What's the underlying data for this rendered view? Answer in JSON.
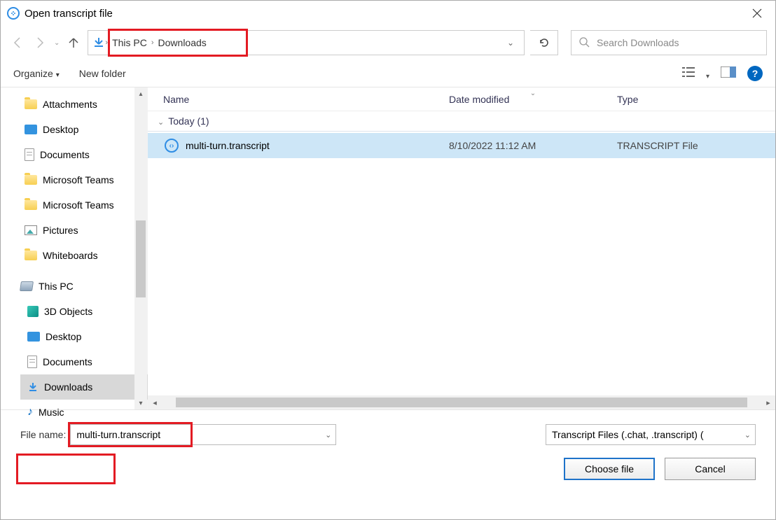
{
  "title": "Open transcript file",
  "path": {
    "seg1": "This PC",
    "seg2": "Downloads"
  },
  "search": {
    "placeholder": "Search Downloads"
  },
  "toolbar": {
    "organize": "Organize",
    "newfolder": "New folder"
  },
  "tree": {
    "items": [
      "Attachments",
      "Desktop",
      "Documents",
      "Microsoft Teams",
      "Microsoft Teams",
      "Pictures",
      "Whiteboards"
    ],
    "thispc": "This PC",
    "sub": [
      "3D Objects",
      "Desktop",
      "Documents",
      "Downloads",
      "Music"
    ]
  },
  "columns": {
    "name": "Name",
    "date": "Date modified",
    "type": "Type"
  },
  "group": {
    "label": "Today (1)"
  },
  "file": {
    "name": "multi-turn.transcript",
    "date": "8/10/2022 11:12 AM",
    "type": "TRANSCRIPT File"
  },
  "filename": {
    "label": "File name:",
    "value": "multi-turn.transcript"
  },
  "filter": {
    "label": "Transcript Files (.chat, .transcript) ("
  },
  "buttons": {
    "choose": "Choose file",
    "cancel": "Cancel"
  }
}
